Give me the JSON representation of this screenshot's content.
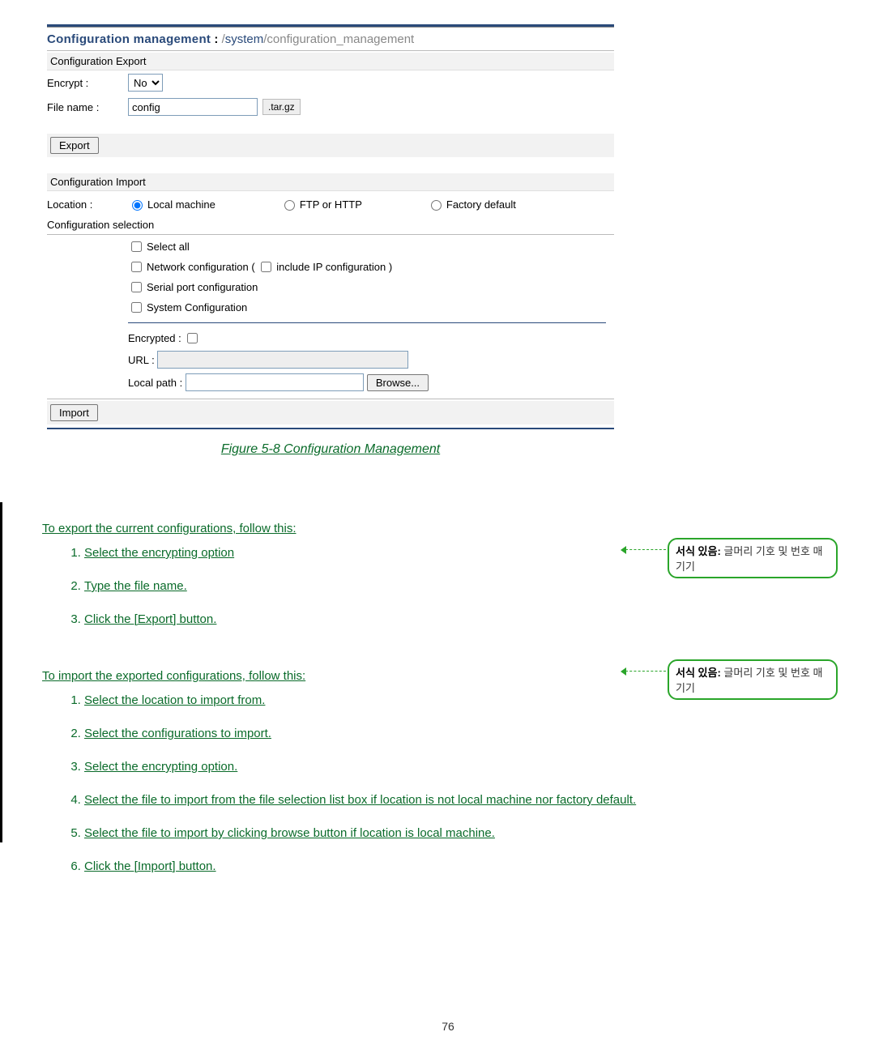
{
  "panel": {
    "title_main": "Configuration management",
    "colon": " : ",
    "slash1": "/",
    "path_seg1": "system",
    "slash2": "/",
    "path_seg2": "configuration_management",
    "export_head": "Configuration Export",
    "encrypt_label": "Encrypt :",
    "encrypt_value": "No",
    "filename_label": "File name :",
    "filename_value": "config",
    "file_ext": ".tar.gz",
    "export_btn": "Export",
    "import_head": "Configuration Import",
    "location_label": "Location :",
    "loc_local": "Local machine",
    "loc_ftp": "FTP or HTTP",
    "loc_factory": "Factory default",
    "cfg_sel_head": "Configuration selection",
    "cfg_all": "Select all",
    "cfg_net": "Network configuration (",
    "cfg_net_ip": " include IP configuration )",
    "cfg_serial": "Serial port configuration",
    "cfg_system": "System Configuration",
    "encrypted_label": "Encrypted :",
    "url_label": "URL :",
    "localpath_label": "Local path :",
    "browse_btn": "Browse...",
    "import_btn": "Import"
  },
  "caption": {
    "fig_label": "Figure ",
    "fig_num": "5-8",
    "fig_title": " Configuration Management"
  },
  "instructions": {
    "export_head": "To export the current configurations, follow this:",
    "export_steps": {
      "s1": "Select the encrypting option",
      "s2": "Type the file name.",
      "s3": "Click the [Export] button."
    },
    "import_head": "To import the exported configurations, follow this:",
    "import_steps": {
      "s1": "Select the location to import from.",
      "s2": "Select the configurations to import.",
      "s3": "Select the encrypting option.",
      "s4": "Select the file to import from the file selection list box if location is not local machine nor factory default.",
      "s5": "Select the file to import by clicking browse button if location is local machine.",
      "s6": "Click the [Import] button."
    }
  },
  "balloons": {
    "b1_strong": "서식 있음:",
    "b1_rest": " 글머리 기호 및 번호 매기기",
    "b2_strong": "서식 있음:",
    "b2_rest": " 글머리 기호 및 번호 매기기"
  },
  "page_number": "76"
}
